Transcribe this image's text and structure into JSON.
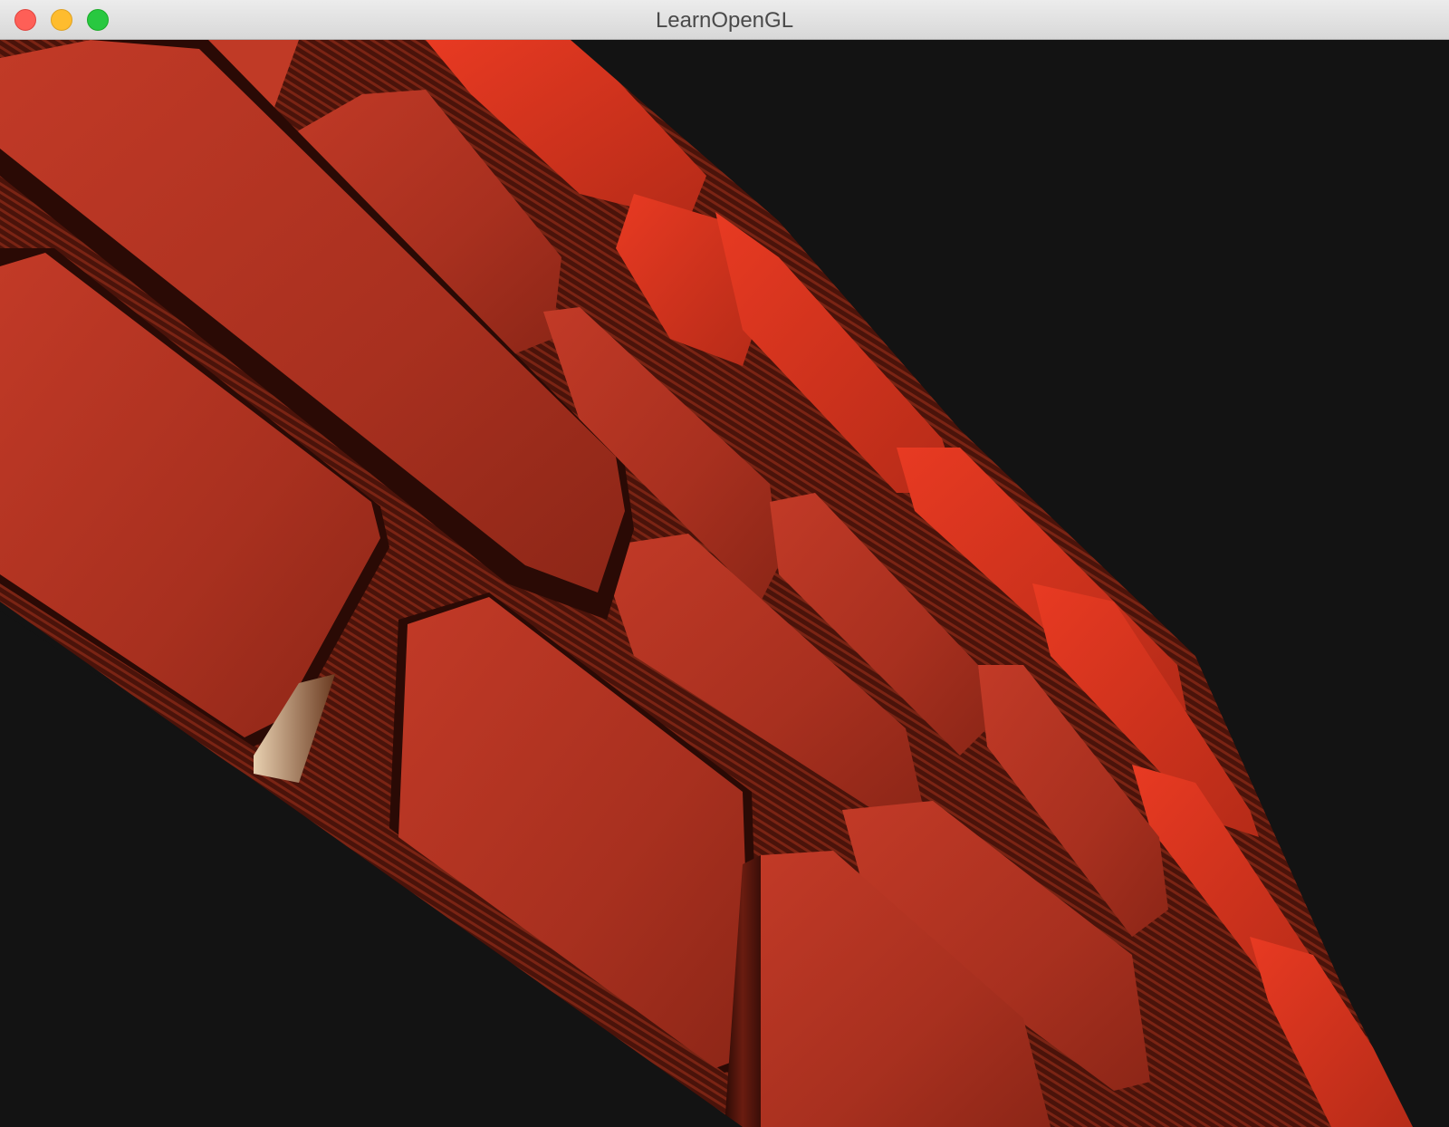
{
  "window": {
    "title": "LearnOpenGL",
    "buttons": {
      "close": "close-icon",
      "minimize": "minimize-icon",
      "zoom": "zoom-icon"
    },
    "colors": {
      "close": "#fe5f57",
      "minimize": "#febc2e",
      "zoom": "#28c840"
    }
  },
  "scene": {
    "description_icon": "parallax-occlusion-brick-wall",
    "background_color": "#131313",
    "brick_color": "#b8321f",
    "brick_highlight": "#e8391f",
    "brick_shadow": "#3a0e08"
  }
}
